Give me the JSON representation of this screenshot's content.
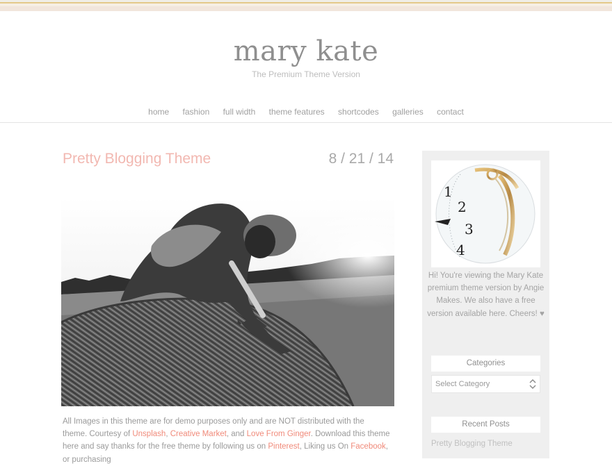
{
  "header": {
    "site_title": "mary kate",
    "tagline": "The Premium Theme Version"
  },
  "nav": {
    "items": [
      "home",
      "fashion",
      "full width",
      "theme features",
      "shortcodes",
      "galleries",
      "contact"
    ]
  },
  "post": {
    "title": "Pretty Blogging Theme",
    "date": "8 / 21 / 14",
    "text_1": "All Images in this theme are for demo purposes only and are NOT distributed with the theme.  Courtesy of ",
    "link_unsplash": "Unsplash",
    "sep_1": ", ",
    "link_creative_market": "Creative Market",
    "sep_2": ", and ",
    "link_love_from_ginger": "Love From Ginger",
    "text_2": ".  Download this theme here and say thanks for the free theme by following us on ",
    "link_pinterest": "Pinterest",
    "text_3": ", Liking us On ",
    "link_facebook": "Facebook",
    "text_4": ", or purchasing"
  },
  "sidebar": {
    "clock_numbers": [
      "1",
      "2",
      "3",
      "4"
    ],
    "bio": "Hi! You're viewing the Mary Kate premium theme version by Angie Makes. We also have a free version available here. Cheers! ♥",
    "categories_title": "Categories",
    "category_select_value": "Select Category",
    "recent_posts_title": "Recent Posts",
    "recent_posts": [
      "Pretty Blogging Theme"
    ]
  },
  "colors": {
    "accent_pink": "#f2b8b1",
    "link_coral": "#f08a7a",
    "text_gray": "#8f8f8f",
    "sidebar_bg": "#efefef"
  }
}
